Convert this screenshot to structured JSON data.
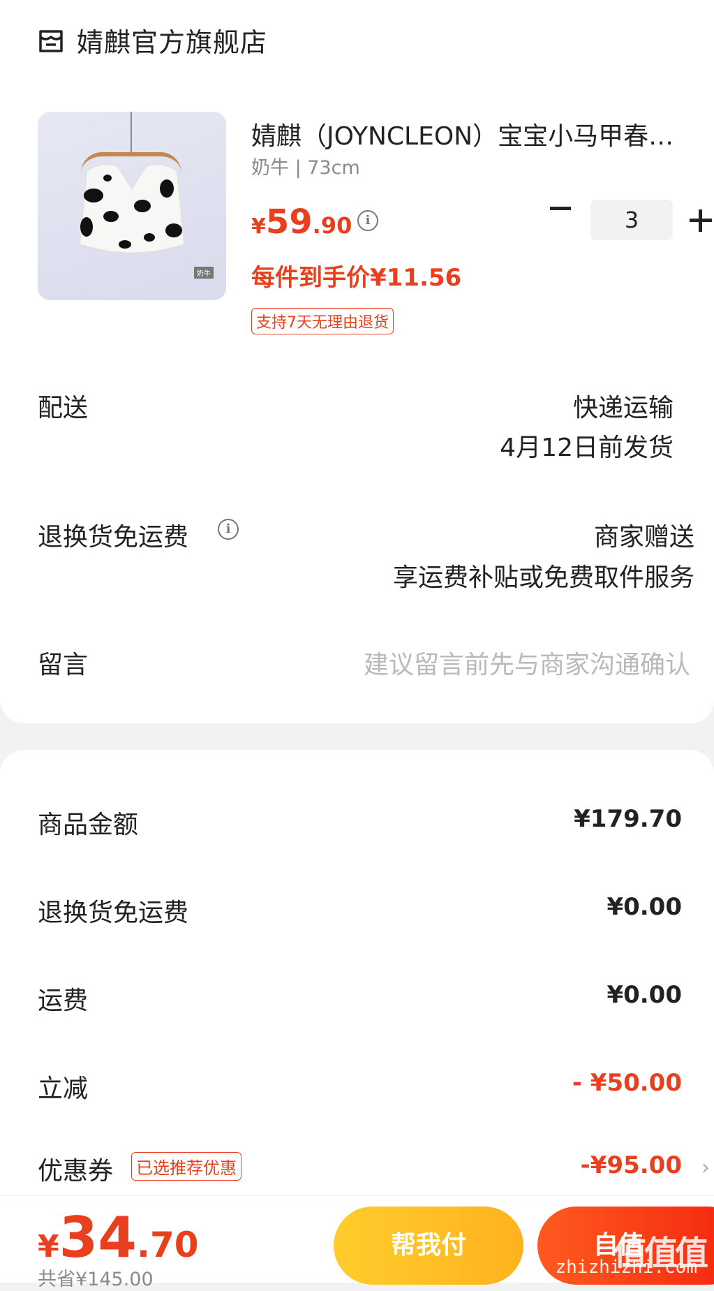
{
  "store": {
    "name": "婧麒官方旗舰店",
    "icon": "store-icon"
  },
  "product": {
    "title": "婧麒（JOYNCLEON）宝宝小马甲春…",
    "spec": "奶牛 | 73cm",
    "price_symbol": "¥",
    "price_int": "59",
    "price_dec": ".90",
    "quantity": "3",
    "unit_price": "每件到手价¥11.56",
    "return_badge": "支持7天无理由退货",
    "image_tag": "奶牛"
  },
  "delivery": {
    "label": "配送",
    "method": "快递运输",
    "ship_date": "4月12日前发货"
  },
  "return_shipping": {
    "label": "退换货免运费",
    "value": "商家赠送",
    "detail": "享运费补贴或免费取件服务"
  },
  "message": {
    "label": "留言",
    "placeholder": "建议留言前先与商家沟通确认"
  },
  "summary": {
    "goods_label": "商品金额",
    "goods_value": "¥179.70",
    "return_label": "退换货免运费",
    "return_value": "¥0.00",
    "shipping_label": "运费",
    "shipping_value": "¥0.00",
    "discount_label": "立减",
    "discount_value": "- ¥50.00",
    "coupon_label": "优惠券",
    "coupon_badge": "已选推荐优惠",
    "coupon_value": "-¥95.00"
  },
  "footer": {
    "total_symbol": "¥",
    "total_int": "34",
    "total_dec": ".70",
    "saved": "共省¥145.00",
    "help_pay": "帮我付",
    "submit": "自值",
    "watermark": "值值值",
    "watermark_url": "zhizhizhi.com"
  },
  "colors": {
    "accent": "#e8401e",
    "help_button": "#ffc02a",
    "pay_button": "#f4320f"
  }
}
